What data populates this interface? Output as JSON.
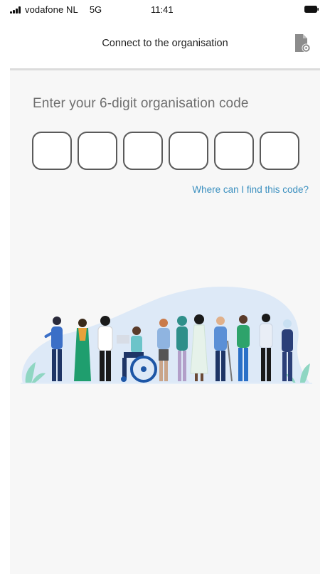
{
  "status_bar": {
    "carrier": "vodafone NL",
    "network": "5G",
    "time": "11:41"
  },
  "header": {
    "title": "Connect to the organisation",
    "icon": "document-settings-icon"
  },
  "main": {
    "instruction": "Enter your 6-digit organisation code",
    "code_digits": [
      "",
      "",
      "",
      "",
      "",
      ""
    ],
    "help_link": "Where can I find this code?",
    "illustration": "diverse-people-illustration"
  },
  "colors": {
    "link": "#3a8fbf",
    "content_background": "#f7f7f7",
    "box_border": "#5a5a5a",
    "illustration_blob": "#dde9f7"
  }
}
